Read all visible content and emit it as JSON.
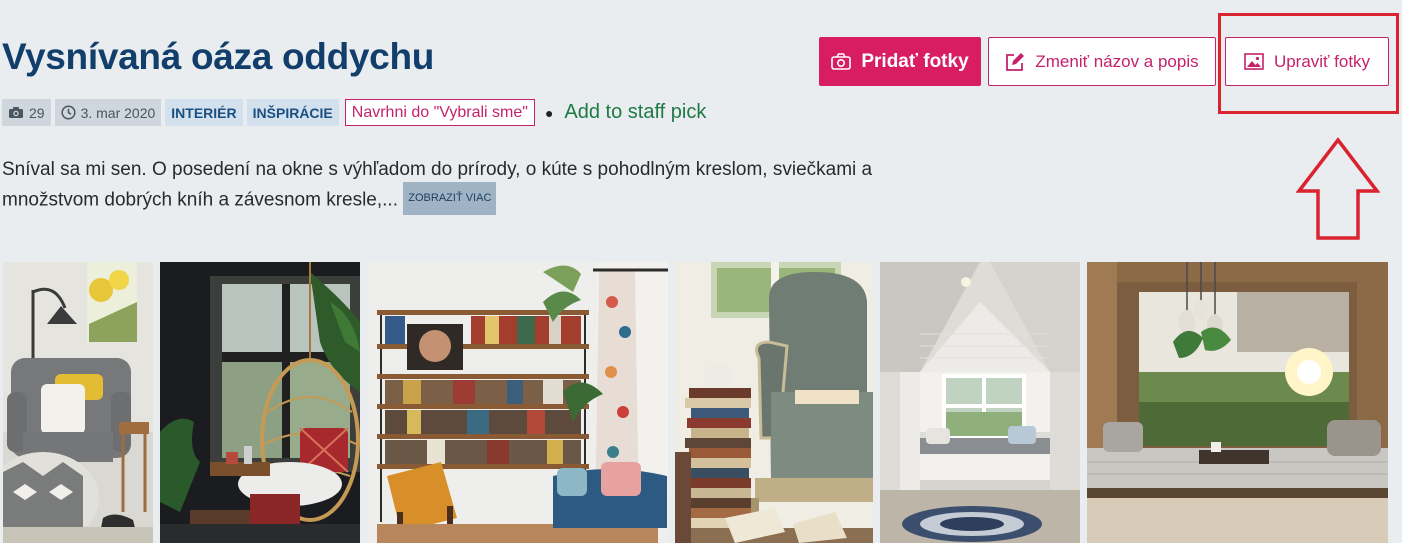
{
  "album": {
    "title": "Vysnívaná oáza oddychu",
    "photo_count": "29",
    "date": "3. mar 2020",
    "tags": [
      "INTERIÉR",
      "INŠPIRÁCIE"
    ],
    "suggest_label": "Navrhni do \"Vybrali sme\"",
    "staff_pick_label": "Add to staff pick",
    "description": "Sníval sa mi sen. O posedení na okne s výhľadom do prírody, o kúte s pohodlným kreslom, sviečkami a množstvom dobrých kníh a závesnom kresle,...",
    "show_more_label": "ZOBRAZIŤ VIAC"
  },
  "actions": {
    "add_photos": "Pridať fotky",
    "rename": "Zmeniť názov a popis",
    "edit_photos": "Upraviť fotky"
  },
  "icons": {
    "camera": "camera-icon",
    "clock": "clock-icon",
    "edit": "edit-icon",
    "image": "image-icon"
  },
  "colors": {
    "brand": "#d81d62",
    "title": "#123e6b",
    "tag_text": "#1b4f80",
    "staff_pick": "#1e7a45",
    "highlight": "#d9232e",
    "background": "#eaedf0"
  },
  "photos": [
    {
      "name": "reading-corner-armchair"
    },
    {
      "name": "hanging-rattan-chair"
    },
    {
      "name": "bookshelf-living-room"
    },
    {
      "name": "armchair-book-stacks"
    },
    {
      "name": "attic-window-seat"
    },
    {
      "name": "window-bench-view"
    }
  ]
}
